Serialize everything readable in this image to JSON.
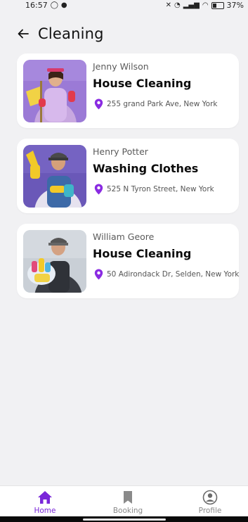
{
  "status_bar": {
    "time": "16:57",
    "battery": "37%"
  },
  "header": {
    "title": "Cleaning",
    "back_icon": "arrow-left-icon"
  },
  "listings": [
    {
      "provider": "Jenny Wilson",
      "service": "House Cleaning",
      "address": "255 grand Park Ave, New York",
      "photo": "cleaner-with-mop-photo"
    },
    {
      "provider": "Henry Potter",
      "service": "Washing Clothes",
      "address": "525 N Tyron Street, New York",
      "photo": "cleaner-with-gloves-photo"
    },
    {
      "provider": "William Geore",
      "service": "House Cleaning",
      "address": "50 Adirondack Dr, Selden, New York",
      "photo": "cleaner-with-supplies-photo"
    }
  ],
  "bottom_nav": {
    "items": [
      {
        "label": "Home",
        "icon": "home-icon",
        "active": true
      },
      {
        "label": "Booking",
        "icon": "bookmark-icon",
        "active": false
      },
      {
        "label": "Profile",
        "icon": "profile-icon",
        "active": false
      }
    ]
  },
  "colors": {
    "accent": "#7a27d9",
    "background": "#f1f1f3",
    "card": "#ffffff"
  }
}
